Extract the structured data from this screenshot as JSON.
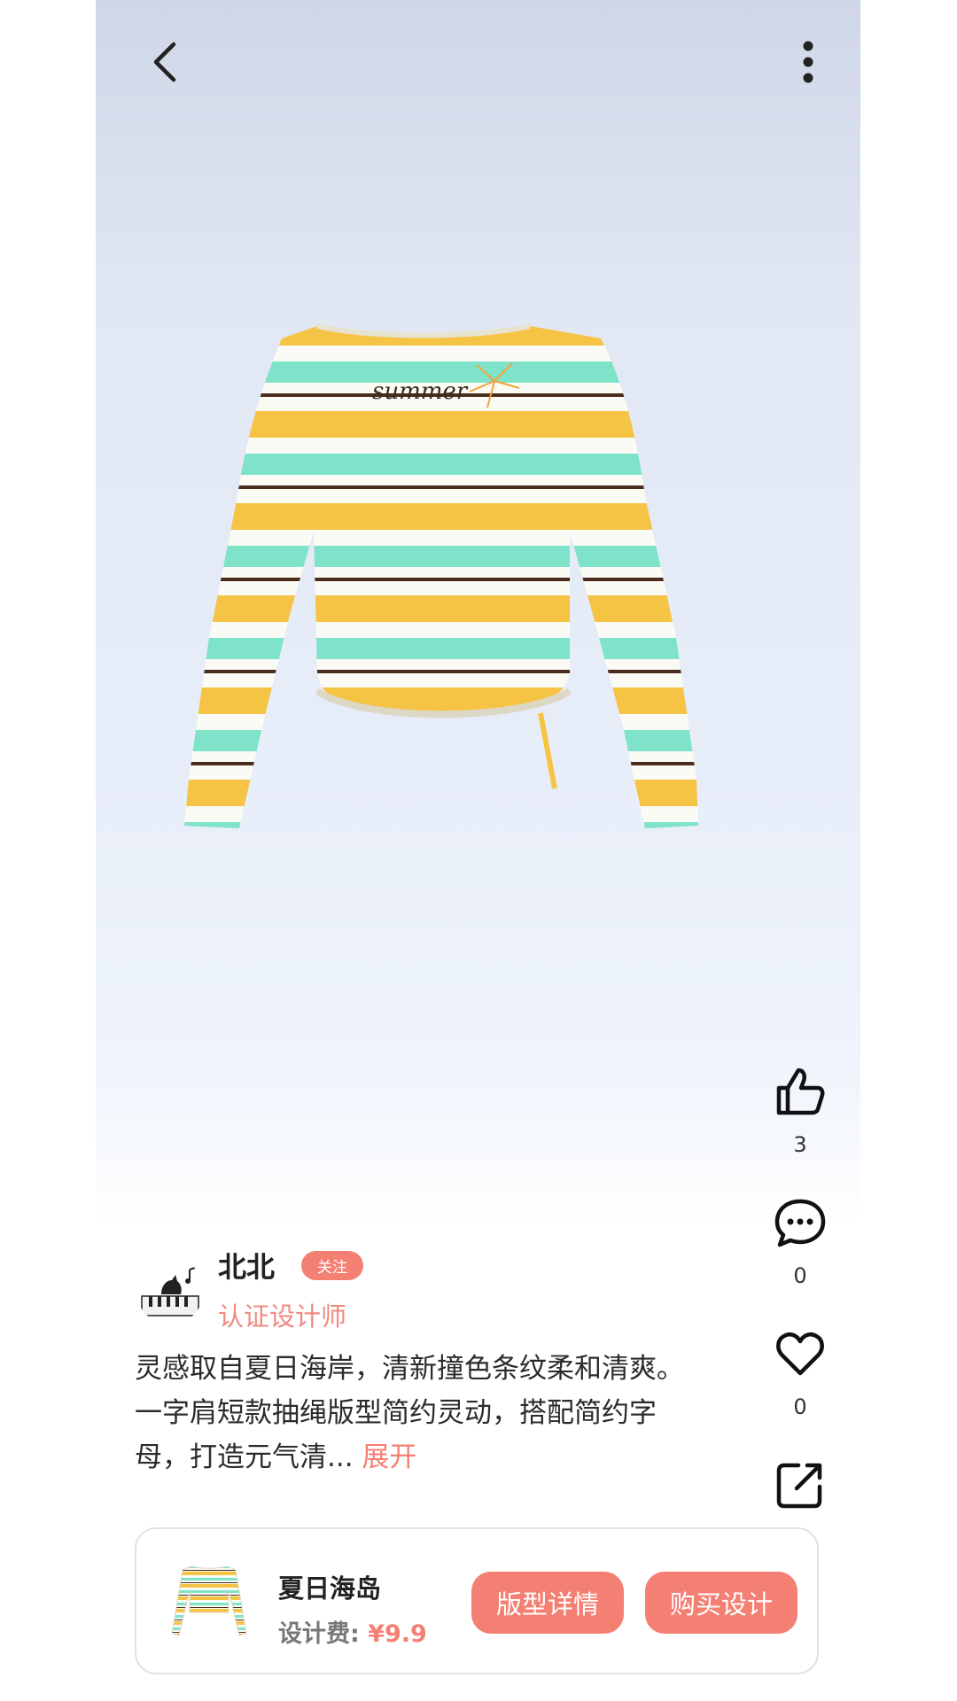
{
  "icons": {
    "back": "chevron-left-icon",
    "more": "vertical-ellipsis-icon",
    "like": "thumbs-up-icon",
    "comment": "comment-bubble-icon",
    "favorite": "heart-icon",
    "share": "share-icon"
  },
  "side_actions": {
    "like_count": "3",
    "comment_count": "0",
    "favorite_count": "0"
  },
  "author": {
    "name": "北北",
    "follow_label": "关注",
    "title": "认证设计师"
  },
  "description": {
    "text": "灵感取自夏日海岸，清新撞色条纹柔和清爽。一字肩短款抽绳版型简约灵动，搭配简约字母，打造元气清...",
    "expand_label": "展开"
  },
  "product_image": {
    "print_text": "summer"
  },
  "product_card": {
    "title": "夏日海岛",
    "price_label": "设计费:",
    "price": "¥9.9",
    "pattern_button": "版型详情",
    "buy_button": "购买设计"
  },
  "colors": {
    "accent": "#f47f73",
    "stripe_yellow": "#f6c445",
    "stripe_mint": "#7ee3c8",
    "stripe_brown": "#4a2d1c"
  }
}
